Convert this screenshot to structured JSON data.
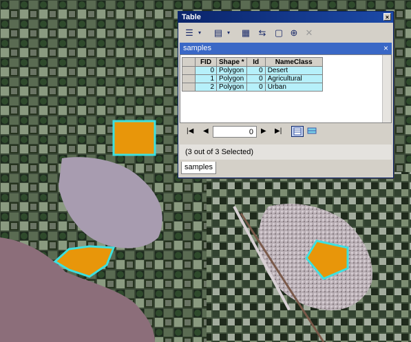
{
  "window": {
    "title": "Table",
    "close_glyph": "×"
  },
  "toolbar": {
    "icons": [
      "table-options-icon",
      "related-tables-icon",
      "select-by-attributes-icon",
      "switch-selection-icon",
      "clear-selection-icon",
      "zoom-to-selected-icon",
      "delete-selected-icon"
    ]
  },
  "table_tab": {
    "name": "samples",
    "close_glyph": "×"
  },
  "columns": [
    "FID",
    "Shape *",
    "Id",
    "NameClass"
  ],
  "rows": [
    [
      "0",
      "Polygon",
      "0",
      "Desert"
    ],
    [
      "1",
      "Polygon",
      "0",
      "Agricultural"
    ],
    [
      "2",
      "Polygon",
      "0",
      "Urban"
    ]
  ],
  "navigation": {
    "current_record": "0"
  },
  "status": "(3 out of 3 Selected)",
  "bottom_tab": "samples",
  "colors": {
    "selected_row": "#b6f0fa",
    "polygon_fill": "#e8960a",
    "polygon_outline": "#3de0e0",
    "title_bar": "#0a246a"
  }
}
